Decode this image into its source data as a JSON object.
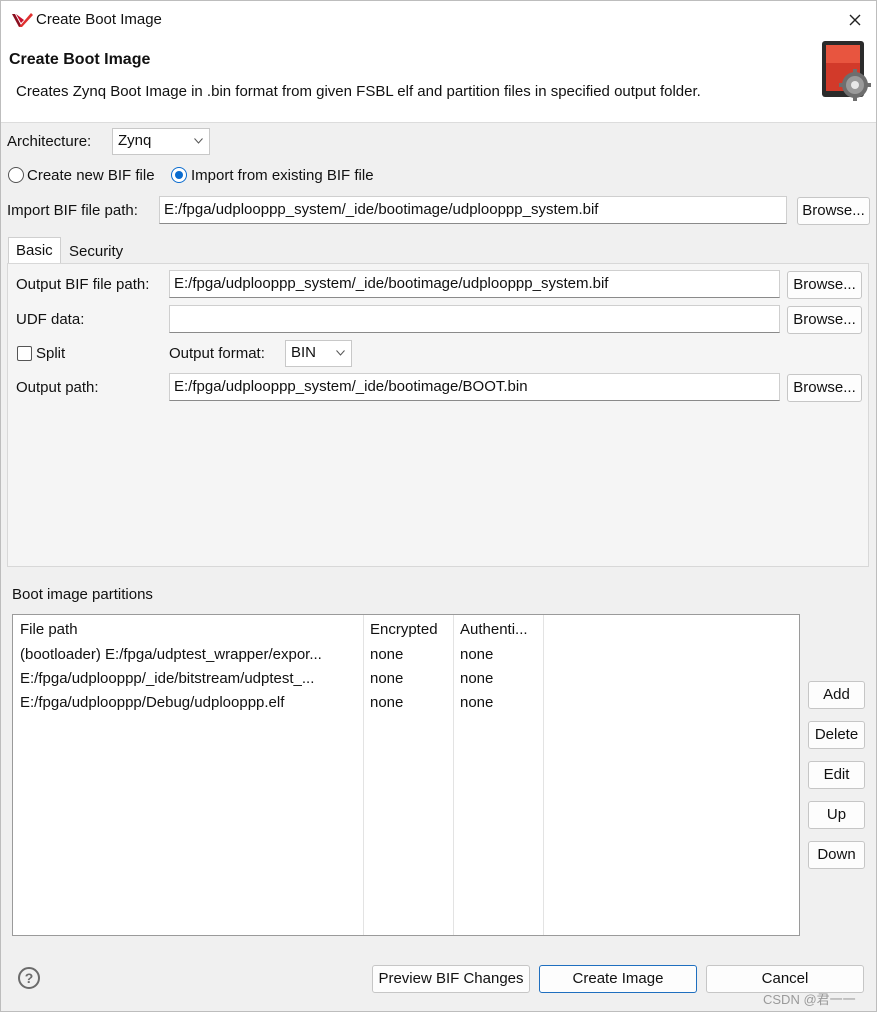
{
  "window": {
    "title": "Create Boot Image"
  },
  "header": {
    "title": "Create Boot Image",
    "description": "Creates Zynq Boot Image in .bin format from given FSBL elf and partition files in specified output folder."
  },
  "architecture": {
    "label": "Architecture:",
    "value": "Zynq"
  },
  "bif_mode": {
    "create_label": "Create new BIF file",
    "import_label": "Import from existing BIF file",
    "selected": "import"
  },
  "import_bif": {
    "label": "Import BIF file path:",
    "value": "E:/fpga/udplooppp_system/_ide/bootimage/udplooppp_system.bif",
    "browse": "Browse..."
  },
  "tabs": [
    {
      "label": "Basic",
      "active": true
    },
    {
      "label": "Security",
      "active": false
    }
  ],
  "basic": {
    "output_bif_label": "Output BIF file path:",
    "output_bif_value": "E:/fpga/udplooppp_system/_ide/bootimage/udplooppp_system.bif",
    "udf_label": "UDF data:",
    "udf_value": "",
    "split_label": "Split",
    "output_format_label": "Output format:",
    "output_format_value": "BIN",
    "output_path_label": "Output path:",
    "output_path_value": "E:/fpga/udplooppp_system/_ide/bootimage/BOOT.bin",
    "browse": "Browse..."
  },
  "partitions": {
    "label": "Boot image partitions",
    "columns": [
      "File path",
      "Encrypted",
      "Authenti..."
    ],
    "rows": [
      [
        "(bootloader) E:/fpga/udptest_wrapper/expor...",
        "none",
        "none"
      ],
      [
        "E:/fpga/udplooppp/_ide/bitstream/udptest_...",
        "none",
        "none"
      ],
      [
        "E:/fpga/udplooppp/Debug/udplooppp.elf",
        "none",
        "none"
      ]
    ],
    "buttons": {
      "add": "Add",
      "delete": "Delete",
      "edit": "Edit",
      "up": "Up",
      "down": "Down"
    }
  },
  "footer": {
    "help": "?",
    "preview": "Preview BIF Changes",
    "create": "Create Image",
    "cancel": "Cancel"
  },
  "watermark": "CSDN @君一一",
  "colors": {
    "accent": "#0b6ccf",
    "logo_red": "#c8102e"
  }
}
